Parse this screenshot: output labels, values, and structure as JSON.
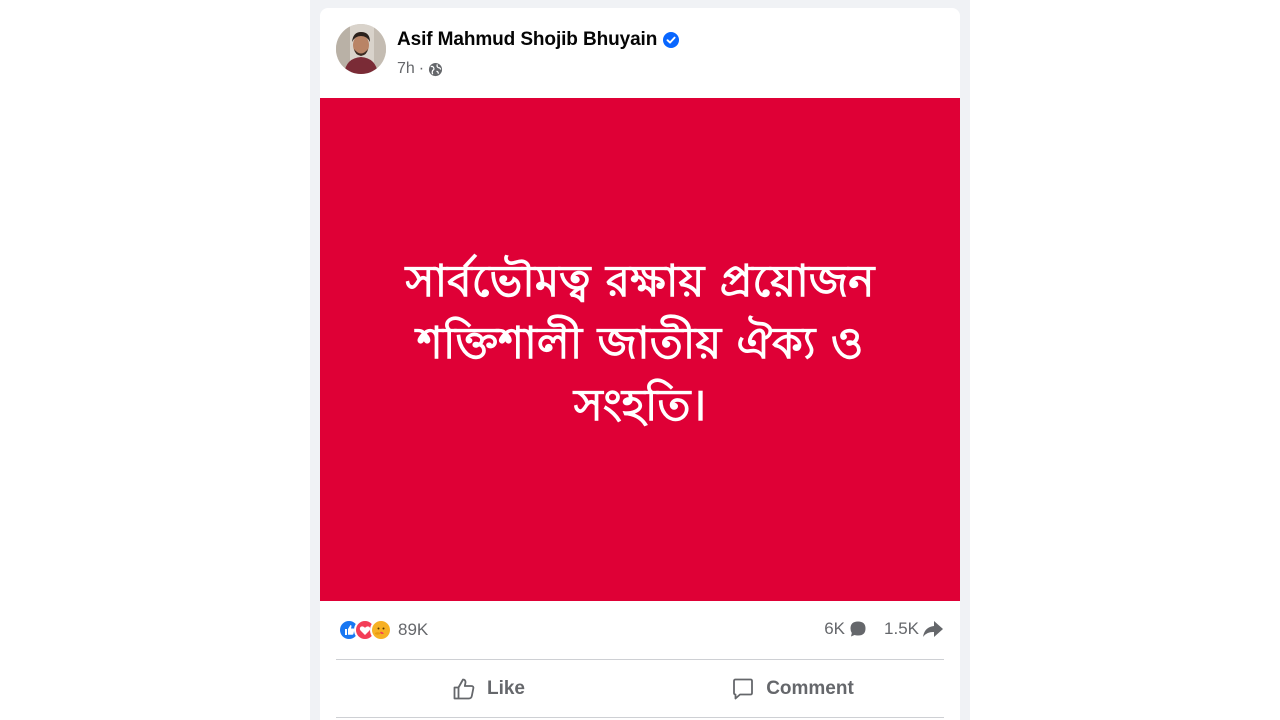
{
  "post": {
    "author": "Asif Mahmud Shojib Bhuyain",
    "verified": true,
    "time": "7h",
    "separator": "·",
    "audience_icon": "globe-icon",
    "image_text": "সার্বভৌমত্ব রক্ষায় প্রয়োজন শক্তিশালী জাতীয় ঐক্য ও সংহতি।",
    "image_bg_color": "#df0036"
  },
  "stats": {
    "reaction_icons": [
      "like-reaction-icon",
      "love-reaction-icon",
      "care-reaction-icon"
    ],
    "reactions_count": "89K",
    "comments_count": "6K",
    "shares_count": "1.5K"
  },
  "actions": {
    "like_label": "Like",
    "comment_label": "Comment"
  },
  "colors": {
    "verified_blue": "#0866ff",
    "text_secondary": "#65676b"
  }
}
